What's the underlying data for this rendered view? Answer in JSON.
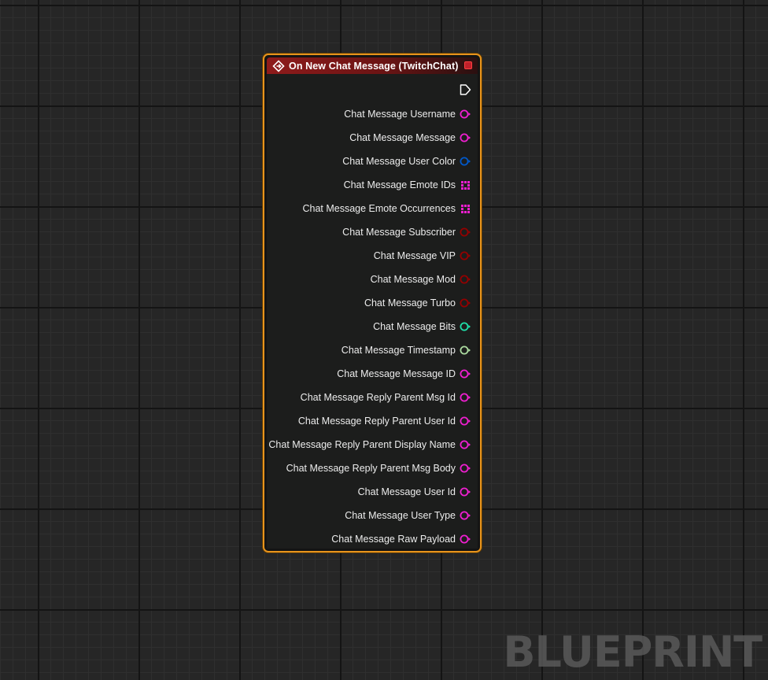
{
  "node": {
    "title": "On New Chat Message (TwitchChat)",
    "border_color": "#e8941c",
    "header_color": "#8e1b1b",
    "event_icon": "event-diamond-icon",
    "delegate_pin_icon": "delegate-square-icon",
    "exec_pin_icon": "exec-output-arrow-icon",
    "pins": [
      {
        "label": "Chat Message Username",
        "type": "string",
        "icon": "string-pin-icon",
        "color": "#f01fd1"
      },
      {
        "label": "Chat Message Message",
        "type": "string",
        "icon": "string-pin-icon",
        "color": "#f01fd1"
      },
      {
        "label": "Chat Message User Color",
        "type": "struct",
        "icon": "struct-pin-icon",
        "color": "#0059cb"
      },
      {
        "label": "Chat Message Emote IDs",
        "type": "string-array",
        "icon": "array-pin-icon",
        "color": "#f01fd1"
      },
      {
        "label": "Chat Message Emote Occurrences",
        "type": "string-array",
        "icon": "array-pin-icon",
        "color": "#f01fd1"
      },
      {
        "label": "Chat Message Subscriber",
        "type": "bool",
        "icon": "bool-pin-icon",
        "color": "#940000"
      },
      {
        "label": "Chat Message VIP",
        "type": "bool",
        "icon": "bool-pin-icon",
        "color": "#940000"
      },
      {
        "label": "Chat Message Mod",
        "type": "bool",
        "icon": "bool-pin-icon",
        "color": "#940000"
      },
      {
        "label": "Chat Message Turbo",
        "type": "bool",
        "icon": "bool-pin-icon",
        "color": "#940000"
      },
      {
        "label": "Chat Message Bits",
        "type": "int",
        "icon": "int-pin-icon",
        "color": "#1fe0aa"
      },
      {
        "label": "Chat Message Timestamp",
        "type": "int64",
        "icon": "int64-pin-icon",
        "color": "#acdca0"
      },
      {
        "label": "Chat Message Message ID",
        "type": "string",
        "icon": "string-pin-icon",
        "color": "#f01fd1"
      },
      {
        "label": "Chat Message Reply Parent Msg Id",
        "type": "string",
        "icon": "string-pin-icon",
        "color": "#f01fd1"
      },
      {
        "label": "Chat Message Reply Parent User Id",
        "type": "string",
        "icon": "string-pin-icon",
        "color": "#f01fd1"
      },
      {
        "label": "Chat Message Reply Parent Display Name",
        "type": "string",
        "icon": "string-pin-icon",
        "color": "#f01fd1"
      },
      {
        "label": "Chat Message Reply Parent Msg Body",
        "type": "string",
        "icon": "string-pin-icon",
        "color": "#f01fd1"
      },
      {
        "label": "Chat Message User Id",
        "type": "string",
        "icon": "string-pin-icon",
        "color": "#f01fd1"
      },
      {
        "label": "Chat Message User Type",
        "type": "string",
        "icon": "string-pin-icon",
        "color": "#f01fd1"
      },
      {
        "label": "Chat Message Raw Payload",
        "type": "string",
        "icon": "string-pin-icon",
        "color": "#f01fd1"
      }
    ]
  },
  "watermark": "BLUEPRINT"
}
